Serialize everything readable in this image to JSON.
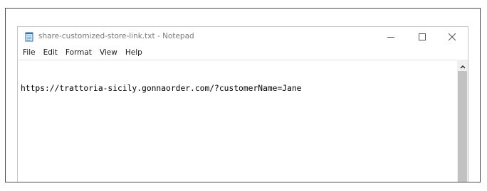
{
  "window": {
    "title": "share-customized-store-link.txt - Notepad",
    "controls": [
      "minimize",
      "maximize",
      "close"
    ]
  },
  "menu": [
    {
      "label": "File"
    },
    {
      "label": "Edit"
    },
    {
      "label": "Format"
    },
    {
      "label": "View"
    },
    {
      "label": "Help"
    }
  ],
  "document": {
    "line_1": "https://trattoria-sicily.gonnaorder.com/?customerName=Jane"
  },
  "icons": {
    "app": "notepad-icon",
    "minimize": "minimize-icon",
    "maximize": "maximize-icon",
    "close": "close-icon",
    "scroll_up": "chevron-up-icon"
  },
  "colors": {
    "title_text": "#7a7a7a",
    "frame_border": "#4a4a4a",
    "scrollbar_track": "#f0f0f0",
    "scrollbar_thumb": "#c2c2c2"
  }
}
